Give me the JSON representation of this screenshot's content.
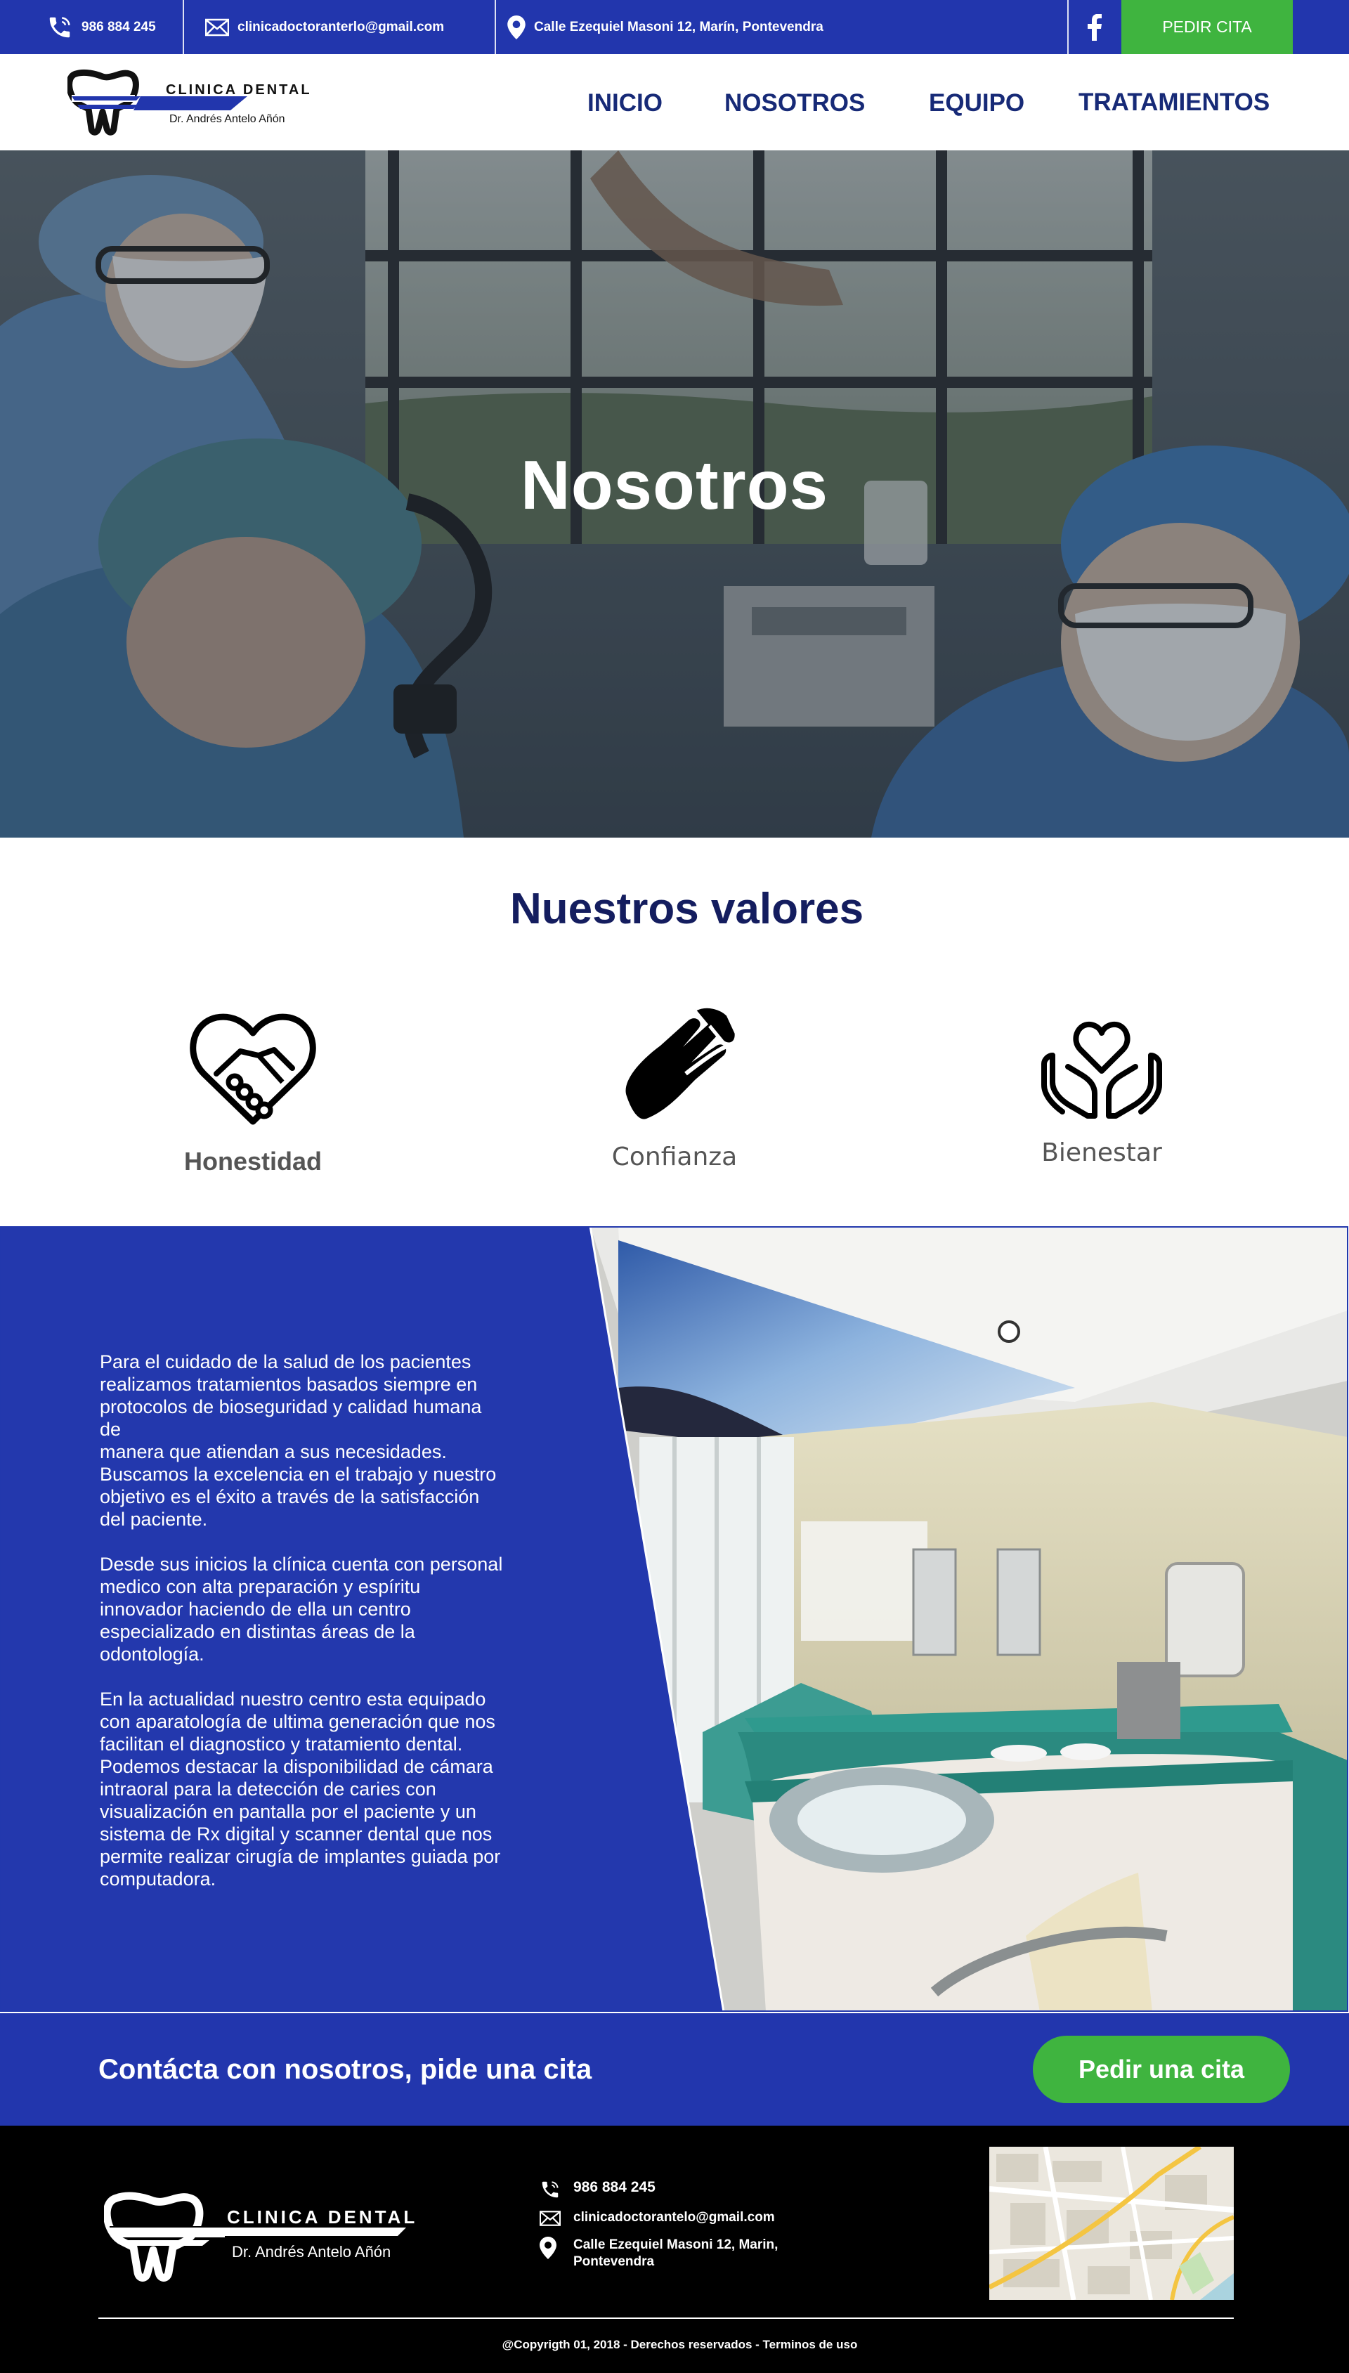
{
  "topbar": {
    "phone": "986 884 245",
    "email": "clinicadoctoranterlo@gmail.com",
    "address": "Calle Ezequiel Masoni 12, Marín, Pontevendra",
    "cta_label": "PEDIR CITA",
    "bg_color": "#2236ad",
    "cta_color": "#3fb43f"
  },
  "logo": {
    "title": "CLINICA DENTAL",
    "subtitle": "Dr. Andrés Antelo Añón"
  },
  "nav": {
    "items": [
      {
        "label": "INICIO"
      },
      {
        "label": "NOSOTROS"
      },
      {
        "label": "EQUIPO"
      },
      {
        "label": "TRATAMIENTOS"
      }
    ]
  },
  "hero": {
    "title": "Nosotros"
  },
  "values": {
    "title": "Nuestros valores",
    "items": [
      {
        "label": "Honestidad",
        "icon": "handshake-heart-icon"
      },
      {
        "label": "Confianza",
        "icon": "helping-hands-icon"
      },
      {
        "label": "Bienestar",
        "icon": "hands-heart-icon"
      }
    ]
  },
  "about": {
    "paragraphs": [
      "Para el cuidado de la salud de los pacientes realizamos tratamientos basados siempre en protocolos de bioseguridad y calidad humana de\nmanera que atiendan a sus necesidades. Buscamos la excelencia en el trabajo y nuestro objetivo es el éxito a través de la satisfacción del paciente.",
      "Desde sus inicios la clínica cuenta con personal medico con alta preparación y espíritu innovador haciendo de ella un centro especializado en distintas áreas de la odontología.",
      "En la actualidad nuestro centro esta equipado con aparatología de ultima generación que nos facilitan el diagnostico y tratamiento dental. Podemos destacar la disponibilidad de cámara intraoral para la detección de caries con visualización en pantalla por el paciente y un sistema de Rx digital y scanner dental que nos permite realizar cirugía de implantes guiada por computadora."
    ]
  },
  "band": {
    "text": "Contácta con nosotros, pide una cita",
    "button_label": "Pedir una cita"
  },
  "footer": {
    "logo_title": "CLINICA DENTAL",
    "logo_subtitle": "Dr. Andrés Antelo Añón",
    "phone": "986 884 245",
    "email": "clinicadoctorantelo@gmail.com",
    "address": "Calle Ezequiel Masoni 12, Marin,\nPontevendra",
    "copyright": "@Copyrigth 01, 2018 - Derechos reservados - Terminos de uso"
  }
}
